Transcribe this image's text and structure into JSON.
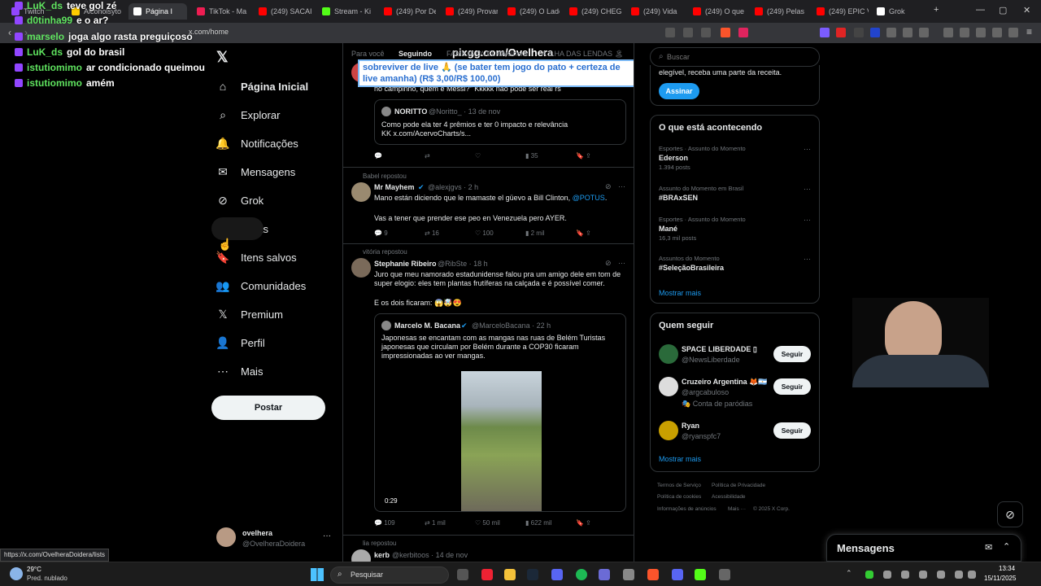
{
  "browser": {
    "tabs": [
      {
        "label": "Twitch",
        "color": "#9146ff"
      },
      {
        "label": "Alcoholsyto",
        "color": "#ffcc00"
      },
      {
        "label": "Página I",
        "color": "#fff"
      },
      {
        "label": "TikTok - Ma",
        "color": "#ee1d52"
      },
      {
        "label": "(249) SACAI",
        "color": "#ff0000"
      },
      {
        "label": "Stream - Ki",
        "color": "#53fc18"
      },
      {
        "label": "(249) Por De",
        "color": "#ff0000"
      },
      {
        "label": "(249) Provar",
        "color": "#ff0000"
      },
      {
        "label": "(249) O Lado",
        "color": "#ff0000"
      },
      {
        "label": "(249) CHEG",
        "color": "#ff0000"
      },
      {
        "label": "(249) Vida",
        "color": "#ff0000"
      },
      {
        "label": "(249) O que",
        "color": "#ff0000"
      },
      {
        "label": "(249) Pelas",
        "color": "#ff0000"
      },
      {
        "label": "(249) EPIC V",
        "color": "#ff0000"
      },
      {
        "label": "Grok",
        "color": "#ffffff"
      }
    ],
    "url": "x.com/home",
    "status_url": "https://x.com/OvelheraDoidera/lists"
  },
  "chat": [
    {
      "user": "LuK_ds",
      "msg": "teve gol zé"
    },
    {
      "user": "d0tinha99",
      "msg": "e o ar?"
    },
    {
      "user": "marselo",
      "msg": "joga algo rasta preguiçoso"
    },
    {
      "user": "LuK_ds",
      "msg": "gol do brasil"
    },
    {
      "user": "istutiomimo",
      "msg": "ar condicionado queimou"
    },
    {
      "user": "istutiomimo",
      "msg": "amém"
    }
  ],
  "overlay": {
    "title": "pixgg.com/Ovelhera",
    "donation": "sobreviver de live 🙏 (se bater tem jogo do pato + certeza de live amanha) (R$ 3,00/R$ 100,00)"
  },
  "nav": [
    {
      "label": "Página Inicial",
      "icon": "⌂",
      "name": "home"
    },
    {
      "label": "Explorar",
      "icon": "⌕",
      "name": "explore"
    },
    {
      "label": "Notificações",
      "icon": "🔔",
      "name": "notifications"
    },
    {
      "label": "Mensagens",
      "icon": "✉",
      "name": "messages"
    },
    {
      "label": "Grok",
      "icon": "⊘",
      "name": "grok"
    },
    {
      "label": "Listas",
      "icon": "☰",
      "name": "lists"
    },
    {
      "label": "Itens salvos",
      "icon": "🔖",
      "name": "bookmarks"
    },
    {
      "label": "Comunidades",
      "icon": "👥",
      "name": "communities"
    },
    {
      "label": "Premium",
      "icon": "𝕏",
      "name": "premium"
    },
    {
      "label": "Perfil",
      "icon": "👤",
      "name": "profile"
    },
    {
      "label": "Mais",
      "icon": "⋯",
      "name": "more"
    }
  ],
  "post_button": "Postar",
  "account": {
    "name": "ovelhera",
    "handle": "@OvelheraDoidera"
  },
  "feed": {
    "tabs": [
      "Para você",
      "Seguindo",
      "FAMILIA OVELHA",
      "Ovelhera",
      "A ILHA DAS LENDAS 🏝"
    ],
    "post0": {
      "text": "no campinho, quem é Messi?\" Kkkkk não pode ser real rs",
      "quote_name": "NORITTO",
      "quote_handle": "@Noritto_ · 13 de nov",
      "quote_text": "Como pode ela ter 4 prêmios e ter 0 impacto e relevância KK x.com/AcervoCharts/s...",
      "replies": "",
      "reposts": "",
      "likes": "",
      "views": "35"
    },
    "post1": {
      "repost_by": "Babel repostou",
      "name": "Mr Mayhem",
      "handle": "@alexjgvs · 2 h",
      "text": "Mano están diciendo que le mamaste el güevo a Bill Clinton,",
      "mention": "@POTUS",
      "text2": "Vas a tener que prender ese peo en Venezuela pero AYER.",
      "replies": "9",
      "reposts": "16",
      "likes": "100",
      "views": "2 mil"
    },
    "post2": {
      "repost_by": "vitória repostou",
      "name": "Stephanie Ribeiro",
      "handle": "@RibSte · 18 h",
      "text": "Juro que meu namorado estadunidense falou pra um amigo dele em tom de super elogio: eles tem plantas frutíferas na calçada e é possível comer.",
      "text2": "E os dois ficaram: 😱🤯😍",
      "quote_name": "Marcelo M. Bacana",
      "quote_handle": "@MarceloBacana · 22 h",
      "quote_text": "Japonesas se encantam com as mangas nas ruas de Belém Turistas japonesas que circulam por Belém durante a COP30 ficaram impressionadas ao ver mangas.",
      "video_time": "0:29",
      "replies": "109",
      "reposts": "1 mil",
      "likes": "50 mil",
      "views": "622 mil"
    },
    "post3": {
      "repost_by": "lia repostou",
      "name": "kerb",
      "handle": "@kerbitoos · 14 de nov"
    }
  },
  "right": {
    "search_placeholder": "Buscar",
    "premium_text": "elegível, receba uma parte da receita.",
    "subscribe": "Assinar",
    "trends_title": "O que está acontecendo",
    "trends": [
      {
        "meta": "Esportes · Assunto do Momento",
        "name": "Ederson",
        "count": "1.394 posts"
      },
      {
        "meta": "Assunto do Momento em Brasil",
        "name": "#BRAxSEN",
        "count": ""
      },
      {
        "meta": "Esportes · Assunto do Momento",
        "name": "Mané",
        "count": "16,3 mil posts"
      },
      {
        "meta": "Assuntos do Momento",
        "name": "#SeleçãoBrasileira",
        "count": ""
      }
    ],
    "show_more": "Mostrar mais",
    "follow_title": "Quem seguir",
    "follow": [
      {
        "name": "SPACE LIBERDADE ▯",
        "handle": "@NewsLiberdade",
        "extra": "",
        "btn": "Seguir"
      },
      {
        "name": "Cruzeiro Argentina 🦊🇦🇷",
        "handle": "@argcabuloso",
        "extra": "🎭 Conta de paródias",
        "btn": "Seguir"
      },
      {
        "name": "Ryan",
        "handle": "@ryanspfc7",
        "extra": "",
        "btn": "Seguir"
      }
    ],
    "footer": [
      "Termos de Serviço",
      "Política de Privacidade",
      "Política de cookies",
      "Acessibilidade",
      "Informações de anúncios",
      "Mais ···",
      "© 2025 X Corp."
    ],
    "messages": "Mensagens"
  },
  "taskbar": {
    "weather_temp": "29°C",
    "weather_desc": "Pred. nublado",
    "search": "Pesquisar",
    "time": "13:34",
    "date": "15/11/2025"
  }
}
